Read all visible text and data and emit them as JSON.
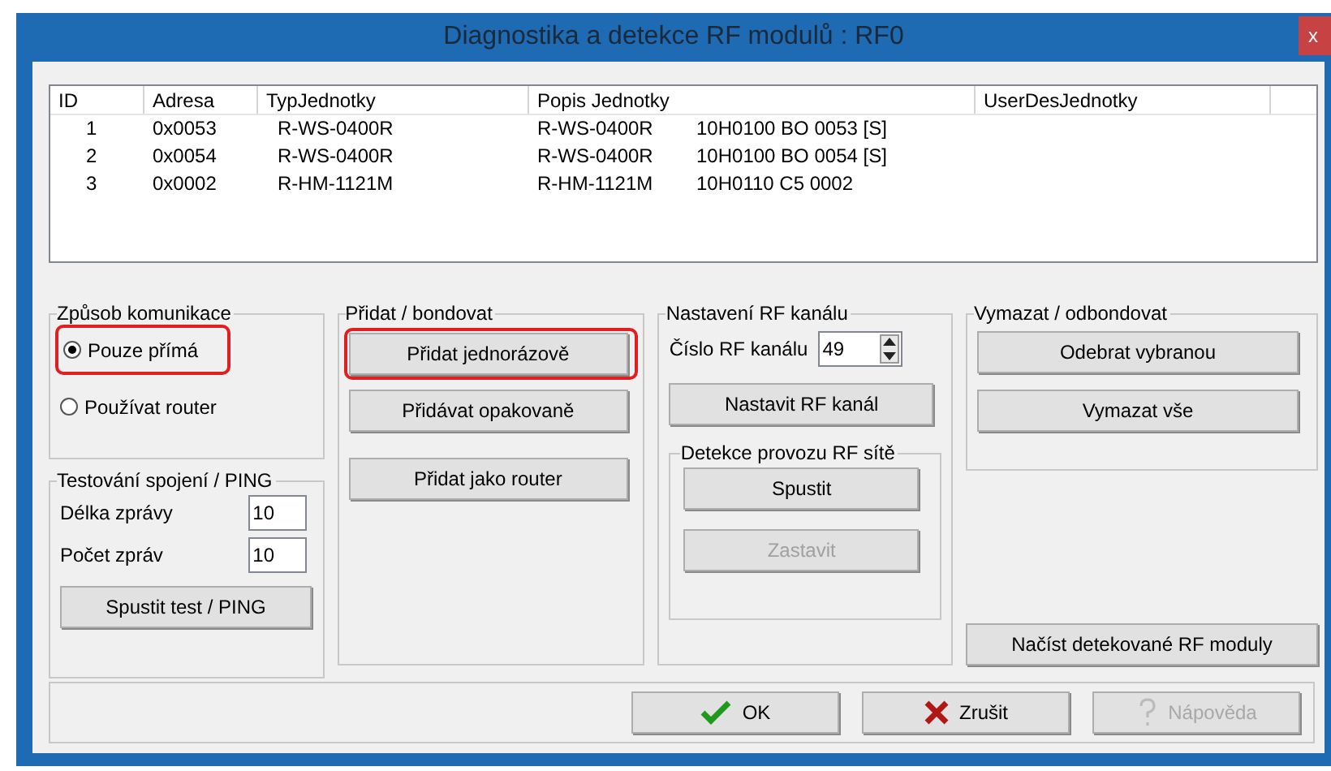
{
  "window": {
    "title": "Diagnostika a detekce RF modulů : RF0",
    "close": "x"
  },
  "table": {
    "columns": [
      "ID",
      "Adresa",
      "TypJednotky",
      "Popis Jednotky",
      "UserDesJednotky"
    ],
    "rows": [
      {
        "id": "1",
        "address": "0x0053",
        "type": "R-WS-0400R",
        "description_model": "R-WS-0400R",
        "description_code": "10H0100 BO 0053 [S]"
      },
      {
        "id": "2",
        "address": "0x0054",
        "type": "R-WS-0400R",
        "description_model": "R-WS-0400R",
        "description_code": "10H0100 BO 0054 [S]"
      },
      {
        "id": "3",
        "address": "0x0002",
        "type": "R-HM-1121M",
        "description_model": "R-HM-1121M",
        "description_code": "10H0110 C5 0002"
      }
    ]
  },
  "communication": {
    "title": "Způsob komunikace",
    "options": [
      {
        "label": "Pouze přímá",
        "selected": true,
        "highlighted": true
      },
      {
        "label": "Používat router",
        "selected": false,
        "highlighted": false
      }
    ]
  },
  "ping": {
    "title": "Testování spojení / PING",
    "fields": [
      {
        "label": "Délka zprávy",
        "value": "10"
      },
      {
        "label": "Počet zpráv",
        "value": "10"
      }
    ],
    "button": "Spustit test / PING"
  },
  "add": {
    "title": "Přidat / bondovat",
    "buttons": [
      {
        "label": "Přidat jednorázově",
        "highlighted": true
      },
      {
        "label": "Přidávat opakovaně",
        "highlighted": false
      },
      {
        "label": "Přidat jako router",
        "highlighted": false
      }
    ]
  },
  "channel": {
    "title": "Nastavení RF kanálu",
    "field": {
      "label": "Číslo RF kanálu",
      "value": "49"
    },
    "button": "Nastavit RF kanál",
    "detection": {
      "title": "Detekce provozu RF sítě",
      "buttons": [
        {
          "label": "Spustit",
          "disabled": false
        },
        {
          "label": "Zastavit",
          "disabled": true
        }
      ]
    }
  },
  "remove": {
    "title": "Vymazat / odbondovat",
    "buttons": [
      "Odebrat vybranou",
      "Vymazat vše"
    ]
  },
  "load_button": "Načíst detekované RF moduly",
  "footer": {
    "buttons": [
      {
        "label": "OK",
        "kind": "ok",
        "disabled": false
      },
      {
        "label": "Zrušit",
        "kind": "cancel",
        "disabled": false
      },
      {
        "label": "Nápověda",
        "kind": "help",
        "disabled": true
      }
    ]
  }
}
